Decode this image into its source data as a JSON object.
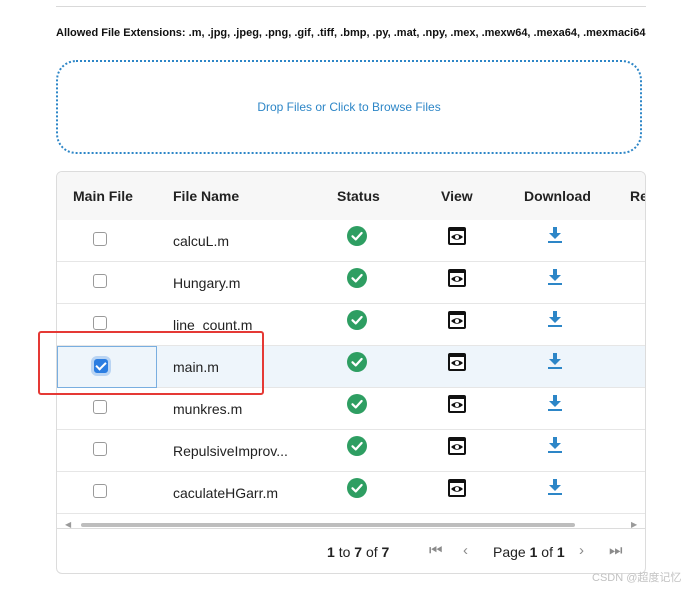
{
  "upload": {
    "allowed_text": "Allowed File Extensions: .m, .jpg, .jpeg, .png, .gif, .tiff, .bmp, .py, .mat, .npy, .mex, .mexw64, .mexa64, .mexmaci64",
    "dropzone_text": "Drop Files or Click to Browse Files"
  },
  "table": {
    "columns": [
      "Main File",
      "File Name",
      "Status",
      "View",
      "Download",
      "Re"
    ],
    "rows": [
      {
        "name": "calcuL.m",
        "main": false
      },
      {
        "name": "Hungary.m",
        "main": false
      },
      {
        "name": "line_count.m",
        "main": false
      },
      {
        "name": "main.m",
        "main": true
      },
      {
        "name": "munkres.m",
        "main": false
      },
      {
        "name": "RepulsiveImprov...",
        "main": false
      },
      {
        "name": "caculateHGarr.m",
        "main": false
      }
    ],
    "status_icon": "check-circle-icon",
    "view_icon": "eye-icon",
    "download_icon": "download-icon",
    "status_color": "#2e9e62",
    "download_color": "#2d86c7"
  },
  "pagination": {
    "range_prefix": "1",
    "range_to": "to",
    "range_end": "7",
    "range_of": "of",
    "range_total": "7",
    "page_word": "Page",
    "page_current": "1",
    "page_of": "of",
    "page_total": "1"
  },
  "watermark": "CSDN @超度记忆"
}
